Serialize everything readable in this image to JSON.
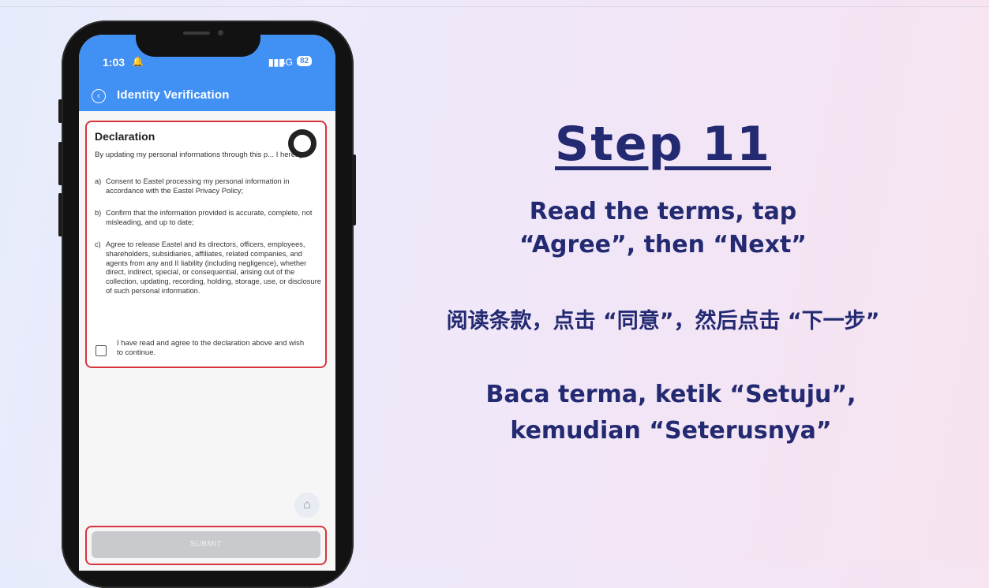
{
  "status_bar": {
    "time": "1:03",
    "bell": "🔔",
    "signal": "▮▮▮",
    "network": "4G",
    "battery": "82"
  },
  "header": {
    "back_icon": "‹",
    "title": "Identity Verification"
  },
  "declaration": {
    "title": "Declaration",
    "intro": "By updating my personal informations through this p... I hereby:",
    "items": [
      {
        "label": "a)",
        "text": "Consent to Eastel processing my personal information in accordance with the Eastel Privacy Policy;"
      },
      {
        "label": "b)",
        "text": "Confirm that the information provided is accurate, complete, not misleading, and up to date;"
      },
      {
        "label": "c)",
        "text": "Agree to release Eastel and its directors, officers, employees, shareholders, subsidiaries, affiliates, related companies, and agents from any and II liability (including negligence), whether direct, indirect, special, or consequential, arising out of the collection, updating, recording, holding, storage, use, or disclosure of such personal information."
      }
    ],
    "agree_text": "I have read and agree to the declaration above and wish to continue."
  },
  "home_icon": "⌂",
  "submit_label": "SUBMIT",
  "instructions": {
    "step": "Step 11",
    "en_line1": "Read the terms, tap",
    "en_line2": "“Agree”, then “Next”",
    "zh": "阅读条款，点击 “同意”，然后点击 “下一步”",
    "ms_line1": "Baca terma, ketik “Setuju”,",
    "ms_line2": "kemudian “Seterusnya”"
  },
  "colors": {
    "header_blue": "#4190f4",
    "highlight_red": "#d9343c",
    "title_navy": "#242a72"
  }
}
